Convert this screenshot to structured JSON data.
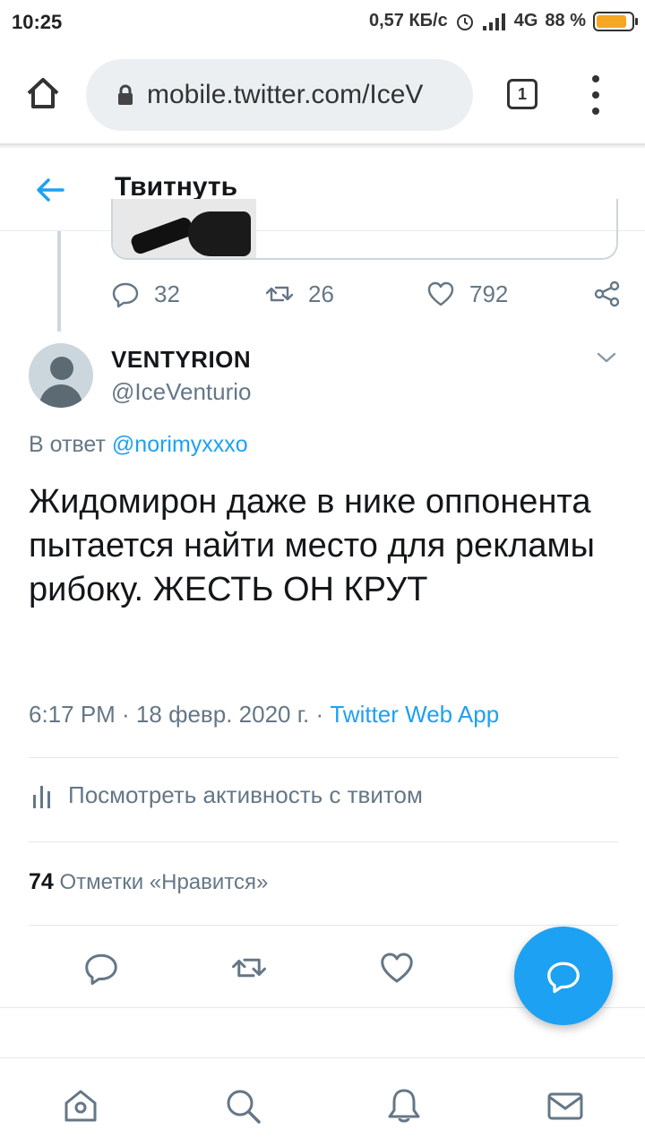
{
  "status_bar": {
    "time": "10:25",
    "speed": "0,57 КБ/с",
    "network": "4G",
    "battery": "88 %",
    "battery_level": 0.88
  },
  "browser": {
    "url": "mobile.twitter.com/IceV",
    "tab_count": "1"
  },
  "header": {
    "title": "Твитнуть"
  },
  "quoted_actions": {
    "replies": "32",
    "retweets": "26",
    "likes": "792"
  },
  "tweet": {
    "name": "VENTYRION",
    "handle": "@IceVenturio",
    "reply_prefix": "В ответ",
    "reply_mention": "@norimyxxxo",
    "text": "Жидомирон даже в нике оппонента пытается найти место для рекламы рибоку. ЖЕСТЬ ОН КРУТ",
    "time": "6:17 PM · 18 февр. 2020 г. · ",
    "source": "Twitter Web App"
  },
  "activity": {
    "label": "Посмотреть активность с твитом"
  },
  "likes": {
    "count": "74",
    "label": "Отметки «Нравится»"
  },
  "colors": {
    "accent": "#1da1f2",
    "muted": "#657786",
    "text": "#14171a"
  },
  "icons": {
    "home": "home-icon",
    "lock": "lock-icon",
    "reply": "reply-icon",
    "retweet": "retweet-icon",
    "like": "heart-icon",
    "share": "share-icon",
    "compose": "compose-reply-icon",
    "search": "search-icon",
    "notifications": "bell-icon",
    "messages": "mail-icon"
  }
}
